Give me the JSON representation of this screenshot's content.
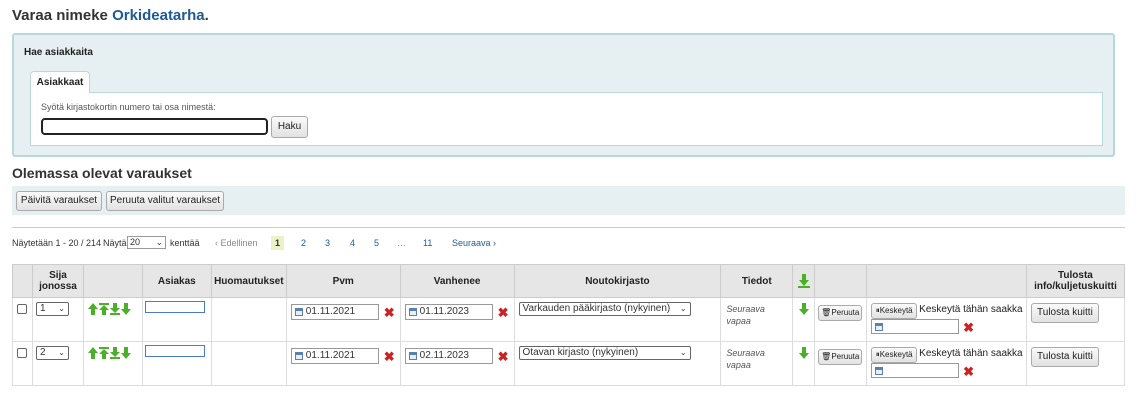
{
  "page": {
    "title_prefix": "Varaa nimeke ",
    "title_link": "Orkideatarha",
    "title_suffix": "."
  },
  "search": {
    "legend": "Hae asiakkaita",
    "tab_label": "Asiakkaat",
    "hint": "Syötä kirjastokortin numero tai osa nimestä:",
    "input_value": "",
    "button_label": "Haku"
  },
  "existing": {
    "title": "Olemassa olevat varaukset",
    "update_button": "Päivitä varaukset",
    "cancel_selected_button": "Peruuta valitut varaukset"
  },
  "pager": {
    "showing": "Näytetään 1 - 20 / 214",
    "show_label": "Näytä",
    "page_size": "20",
    "fields_label": "kenttää",
    "prev": "‹ Edellinen",
    "pages": [
      "1",
      "2",
      "3",
      "4",
      "5"
    ],
    "ellipsis": "…",
    "last_page": "11",
    "next": "Seuraava ›",
    "current": "1"
  },
  "table": {
    "headers": {
      "rank": "Sija jonossa",
      "patron": "Asiakas",
      "notes": "Huomautukset",
      "date": "Pvm",
      "expires": "Vanhenee",
      "pickup": "Noutokirjasto",
      "details": "Tiedot",
      "print": "Tulosta info/kuljetuskuitti"
    },
    "rows": [
      {
        "rank": "1",
        "date": "01.11.2021",
        "expires": "01.11.2023",
        "pickup": "Varkauden pääkirjasto (nykyinen)",
        "info_line1": "Seuraava",
        "info_line2": "vapaa",
        "cancel_label": "Peruuta",
        "suspend_label": "Keskeytä",
        "suspend_until": "Keskeytä tähän saakka",
        "print_label": "Tulosta kuitti"
      },
      {
        "rank": "2",
        "date": "01.11.2021",
        "expires": "02.11.2023",
        "pickup": "Otavan kirjasto (nykyinen)",
        "info_line1": "Seuraava",
        "info_line2": "vapaa",
        "cancel_label": "Peruuta",
        "suspend_label": "Keskeytä",
        "suspend_until": "Keskeytä tähän saakka",
        "print_label": "Tulosta kuitti"
      }
    ]
  },
  "colors": {
    "link": "#1d5a99",
    "panel_bg": "#e6f0f2",
    "panel_border": "#b9d8d9",
    "delete_x": "#cc2222",
    "arrow_green": "#4caf2a",
    "current_page_bg": "#eaf3c8"
  },
  "icons": [
    "calendar-icon",
    "delete-x-icon",
    "move-up-icon",
    "move-top-icon",
    "move-down-icon",
    "move-bottom-icon",
    "trash-icon",
    "pause-icon",
    "lowest-priority-icon"
  ]
}
